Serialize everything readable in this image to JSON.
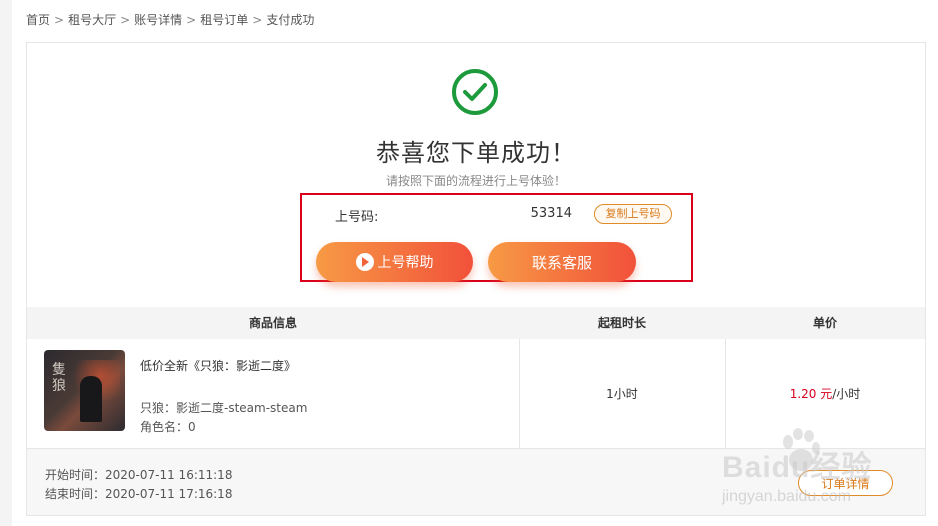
{
  "breadcrumb": {
    "items": [
      "首页",
      "租号大厅",
      "账号详情",
      "租号订单",
      "支付成功"
    ],
    "separator": ">"
  },
  "success": {
    "title": "恭喜您下单成功！",
    "subtitle": "请按照下面的流程进行上号体验！",
    "icon": "check-circle-icon",
    "accent": "#1d9a3c"
  },
  "login_code": {
    "label": "上号码:",
    "value": "53314",
    "copy_label": "复制上号码"
  },
  "actions": {
    "help_label": "上号帮助",
    "service_label": "联系客服"
  },
  "table": {
    "headers": {
      "product": "商品信息",
      "duration": "起租时长",
      "price": "单价"
    },
    "row": {
      "name": "低价全新《只狼：影逝二度》",
      "server": "只狼：影逝二度-steam-steam",
      "role": "角色名：0",
      "duration": "1小时",
      "price_amount": "1.20 元",
      "price_unit": "/小时"
    }
  },
  "times": {
    "start": "开始时间：2020-07-11 16:11:18",
    "end": "结束时间：2020-07-11 17:16:18"
  },
  "order_detail_label": "订单详情",
  "watermark": {
    "text": "Baidu经验",
    "sub": "jingyan.baidu.com"
  },
  "colors": {
    "highlight": "#d9001b",
    "button_gradient_start": "#f79a45",
    "button_gradient_end": "#f1513a",
    "price": "#d9001b"
  }
}
